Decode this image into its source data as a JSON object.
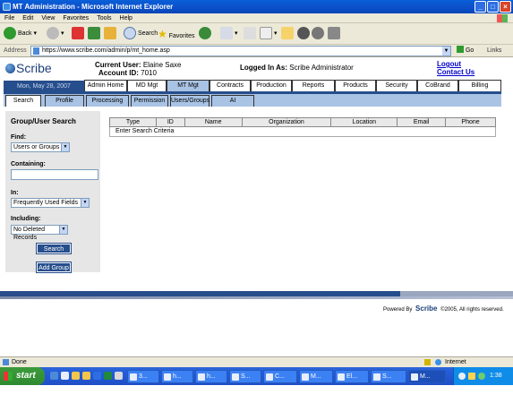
{
  "window": {
    "title": "MT Administration - Microsoft Internet Explorer"
  },
  "menu": [
    "File",
    "Edit",
    "View",
    "Favorites",
    "Tools",
    "Help"
  ],
  "toolbar": {
    "back": "Back",
    "search": "Search",
    "favorites": "Favorites"
  },
  "address": {
    "label": "Address",
    "url": "https://www.scribe.com/admin/p/mt_home.asp",
    "go": "Go",
    "links": "Links"
  },
  "app": {
    "logo": "Scribe",
    "current_user_label": "Current User:",
    "current_user": "Elaine Saxe",
    "account_id_label": "Account ID:",
    "account_id": "7010",
    "logged_in_label": "Logged In As:",
    "logged_in_as": "Scribe Administrator",
    "logout": "Logout",
    "contact": "Contact Us",
    "date": "Mon, May 28, 2007"
  },
  "main_tabs": [
    "Admin Home",
    "MD Mgt",
    "MT Mgt",
    "Contracts",
    "Production",
    "Reports",
    "Products",
    "Security",
    "CoBrand",
    "Billing"
  ],
  "sub_tabs": [
    "Search",
    "Profile",
    "Processing",
    "Permission",
    "Users/Groups",
    "AI"
  ],
  "sidebar": {
    "title": "Group/User Search",
    "find_label": "Find:",
    "find_value": "Users or Groups",
    "containing_label": "Containing:",
    "containing_value": "",
    "in_label": "In:",
    "in_value": "Frequently Used Fields",
    "including_label": "Including:",
    "including_value": "No Deleted Records",
    "search_button": "Search",
    "add_group_button": "Add Group"
  },
  "results": {
    "columns": [
      "Type",
      "ID",
      "Name",
      "Organization",
      "Location",
      "Email",
      "Phone"
    ],
    "message": "Enter Search Criteria"
  },
  "footer": {
    "powered_by": "Powered By",
    "brand": "Scribe",
    "copyright": "©2005, All rights reserved."
  },
  "status": {
    "left": "Done",
    "zone": "Internet"
  },
  "taskbar": {
    "start": "start",
    "tasks": [
      "3...",
      "h...",
      "h...",
      "S...",
      "C...",
      "M...",
      "El...",
      "S...",
      "M..."
    ],
    "clock": "1:38 PM"
  }
}
